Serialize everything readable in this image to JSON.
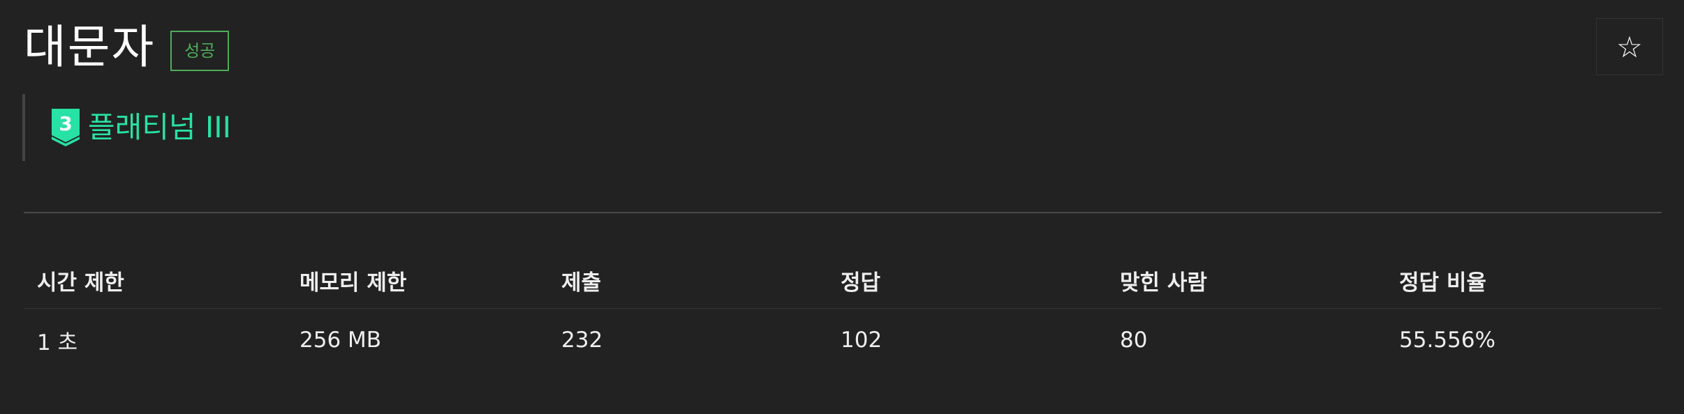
{
  "problem": {
    "title": "대문자",
    "status_badge": "성공",
    "star_glyph": "☆"
  },
  "tier": {
    "level": "3",
    "name": "플래티넘 III",
    "color": "#27e2a4"
  },
  "info_table": {
    "headers": [
      "시간 제한",
      "메모리 제한",
      "제출",
      "정답",
      "맞힌 사람",
      "정답 비율"
    ],
    "values": [
      "1 초",
      "256 MB",
      "232",
      "102",
      "80",
      "55.556%"
    ]
  }
}
